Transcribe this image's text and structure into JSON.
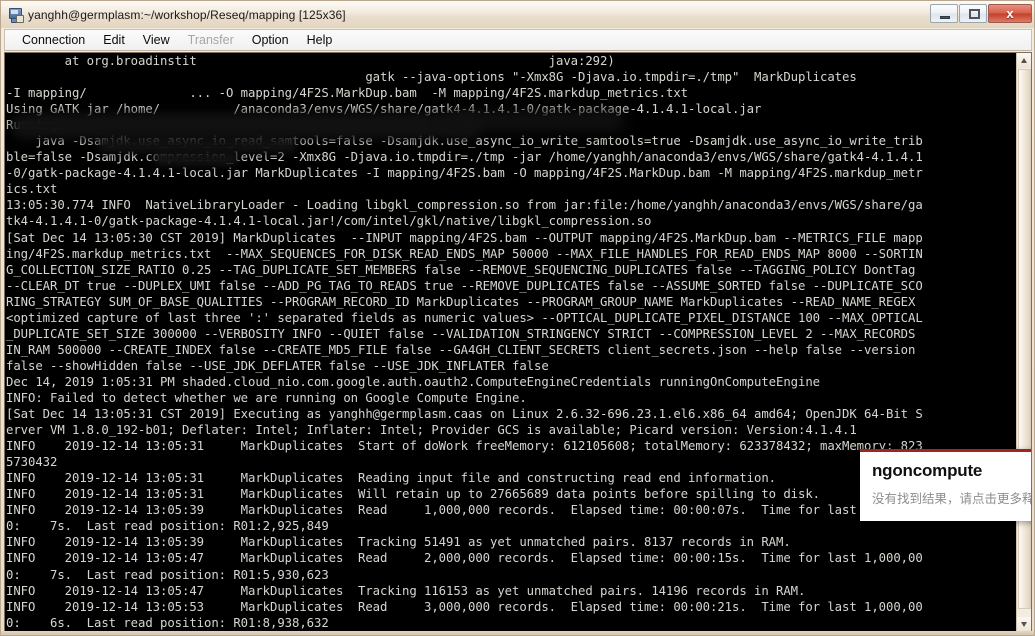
{
  "window": {
    "title": "yanghh@germplasm:~/workshop/Reseq/mapping [125x36]",
    "icon": "terminal-icon",
    "controls": {
      "minimize": "minimize-button",
      "maximize": "maximize-button",
      "close_label": "x"
    }
  },
  "menubar": {
    "items": [
      {
        "label": "Connection",
        "disabled": false
      },
      {
        "label": "Edit",
        "disabled": false
      },
      {
        "label": "View",
        "disabled": false
      },
      {
        "label": "Transfer",
        "disabled": true
      },
      {
        "label": "Option",
        "disabled": false
      },
      {
        "label": "Help",
        "disabled": false
      }
    ]
  },
  "terminal": {
    "lines": [
      "        at org.broadinstit                                                java:292)",
      "                                                 gatk --java-options \"-Xmx8G -Djava.io.tmpdir=./tmp\"  MarkDuplicates",
      "-I mapping/              ... -O mapping/4F2S.MarkDup.bam  -M mapping/4F2S.markdup_metrics.txt",
      "Using GATK jar /home/          /anaconda3/envs/WGS/share/gatk4-4.1.4.1-0/gatk-package-4.1.4.1-local.jar",
      "Running:",
      "    java -Dsamjdk.use_async_io_read_samtools=false -Dsamjdk.use_async_io_write_samtools=true -Dsamjdk.use_async_io_write_trib",
      "ble=false -Dsamjdk.compression_level=2 -Xmx8G -Djava.io.tmpdir=./tmp -jar /home/yanghh/anaconda3/envs/WGS/share/gatk4-4.1.4.1",
      "-0/gatk-package-4.1.4.1-local.jar MarkDuplicates -I mapping/4F2S.bam -O mapping/4F2S.MarkDup.bam -M mapping/4F2S.markdup_metr",
      "ics.txt",
      "13:05:30.774 INFO  NativeLibraryLoader - Loading libgkl_compression.so from jar:file:/home/yanghh/anaconda3/envs/WGS/share/ga",
      "tk4-4.1.4.1-0/gatk-package-4.1.4.1-local.jar!/com/intel/gkl/native/libgkl_compression.so",
      "[Sat Dec 14 13:05:30 CST 2019] MarkDuplicates  --INPUT mapping/4F2S.bam --OUTPUT mapping/4F2S.MarkDup.bam --METRICS_FILE mapp",
      "ing/4F2S.markdup_metrics.txt  --MAX_SEQUENCES_FOR_DISK_READ_ENDS_MAP 50000 --MAX_FILE_HANDLES_FOR_READ_ENDS_MAP 8000 --SORTIN",
      "G_COLLECTION_SIZE_RATIO 0.25 --TAG_DUPLICATE_SET_MEMBERS false --REMOVE_SEQUENCING_DUPLICATES false --TAGGING_POLICY DontTag",
      "--CLEAR_DT true --DUPLEX_UMI false --ADD_PG_TAG_TO_READS true --REMOVE_DUPLICATES false --ASSUME_SORTED false --DUPLICATE_SCO",
      "RING_STRATEGY SUM_OF_BASE_QUALITIES --PROGRAM_RECORD_ID MarkDuplicates --PROGRAM_GROUP_NAME MarkDuplicates --READ_NAME_REGEX",
      "<optimized capture of last three ':' separated fields as numeric values> --OPTICAL_DUPLICATE_PIXEL_DISTANCE 100 --MAX_OPTICAL",
      "_DUPLICATE_SET_SIZE 300000 --VERBOSITY INFO --QUIET false --VALIDATION_STRINGENCY STRICT --COMPRESSION_LEVEL 2 --MAX_RECORDS",
      "IN_RAM 500000 --CREATE_INDEX false --CREATE_MD5_FILE false --GA4GH_CLIENT_SECRETS client_secrets.json --help false --version",
      "false --showHidden false --USE_JDK_DEFLATER false --USE_JDK_INFLATER false",
      "Dec 14, 2019 1:05:31 PM shaded.cloud_nio.com.google.auth.oauth2.ComputeEngineCredentials runningOnComputeEngine",
      "INFO: Failed to detect whether we are running on Google Compute Engine.",
      "[Sat Dec 14 13:05:31 CST 2019] Executing as yanghh@germplasm.caas on Linux 2.6.32-696.23.1.el6.x86_64 amd64; OpenJDK 64-Bit S",
      "erver VM 1.8.0_192-b01; Deflater: Intel; Inflater: Intel; Provider GCS is available; Picard version: Version:4.1.4.1",
      "INFO    2019-12-14 13:05:31     MarkDuplicates  Start of doWork freeMemory: 612105608; totalMemory: 623378432; maxMemory: 823",
      "5730432",
      "INFO    2019-12-14 13:05:31     MarkDuplicates  Reading input file and constructing read end information.",
      "INFO    2019-12-14 13:05:31     MarkDuplicates  Will retain up to 27665689 data points before spilling to disk.",
      "INFO    2019-12-14 13:05:39     MarkDuplicates  Read     1,000,000 records.  Elapsed time: 00:00:07s.  Time for last 1,000,00",
      "0:    7s.  Last read position: R01:2,925,849",
      "INFO    2019-12-14 13:05:39     MarkDuplicates  Tracking 51491 as yet unmatched pairs. 8137 records in RAM.",
      "INFO    2019-12-14 13:05:47     MarkDuplicates  Read     2,000,000 records.  Elapsed time: 00:00:15s.  Time for last 1,000,00",
      "0:    7s.  Last read position: R01:5,930,623",
      "INFO    2019-12-14 13:05:47     MarkDuplicates  Tracking 116153 as yet unmatched pairs. 14196 records in RAM.",
      "INFO    2019-12-14 13:05:53     MarkDuplicates  Read     3,000,000 records.  Elapsed time: 00:00:21s.  Time for last 1,000,00",
      "0:    6s.  Last read position: R01:8,938,632"
    ]
  },
  "dictionary_popup": {
    "word": "ngoncompute",
    "message": "没有找到结果，请点击更多释"
  },
  "scrollbar": {
    "up_arrow": "scroll-up-arrow",
    "down_arrow": "scroll-down-arrow"
  },
  "colors": {
    "terminal_bg": "#000000",
    "terminal_fg": "#d6d6d0",
    "popup_accent": "#9b2720",
    "close_button": "#c33f2b"
  }
}
